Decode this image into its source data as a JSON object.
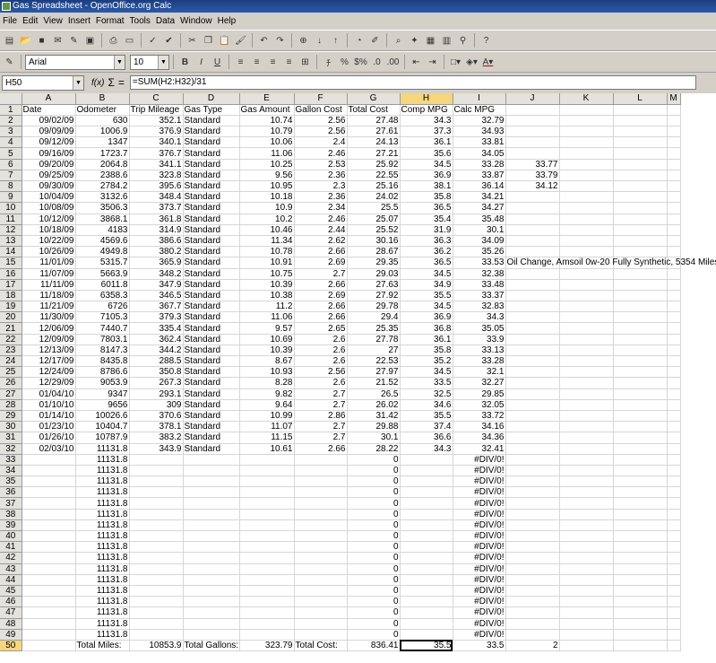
{
  "window": {
    "title": "Gas Spreadsheet - OpenOffice.org Calc"
  },
  "menu": [
    "File",
    "Edit",
    "View",
    "Insert",
    "Format",
    "Tools",
    "Data",
    "Window",
    "Help"
  ],
  "toolbar": {
    "standard_icons": [
      "new-document",
      "open-folder",
      "save",
      "email",
      "edit-file",
      "export-pdf",
      "print",
      "page-preview",
      "spellcheck",
      "autospellcheck",
      "cut",
      "copy",
      "paste",
      "clone-format",
      "undo",
      "redo",
      "hyperlink",
      "sort-ascending",
      "sort-descending",
      "insert-chart",
      "draw-functions",
      "find-replace",
      "navigator",
      "gallery",
      "datasource",
      "zoom",
      "help"
    ],
    "font_name": "Arial",
    "font_size": "10",
    "format_icons": [
      "bold",
      "italic",
      "underline",
      "align-left",
      "align-center",
      "align-right",
      "justify",
      "merge",
      "currency",
      "percent",
      "standard-format",
      "add-decimal",
      "delete-decimal",
      "decrease-indent",
      "increase-indent",
      "borders",
      "background-color",
      "font-color"
    ],
    "labels": {
      "bold": "B",
      "italic": "I",
      "underline": "U",
      "currency": "$",
      "percent": "%",
      "standard": "$%"
    }
  },
  "formula_bar": {
    "cell_ref": "H50",
    "fx": "f(x)",
    "sum": "Σ",
    "equals": "=",
    "formula": "=SUM(H2:H32)/31"
  },
  "sheet": {
    "columns": [
      "A",
      "B",
      "C",
      "D",
      "E",
      "F",
      "G",
      "H",
      "I",
      "J",
      "K",
      "L",
      "M"
    ],
    "selected_column": "H",
    "selected_row": "50",
    "active_cell": "H50",
    "rows": [
      [
        "1",
        "Date",
        "Odometer",
        "Trip Mileage",
        "Gas Type",
        "Gas Amount",
        "Gallon Cost",
        "Total Cost",
        "Comp MPG",
        "Calc MPG",
        "",
        "",
        "",
        ""
      ],
      [
        "2",
        "09/02/09",
        "630",
        "352.1",
        "Standard",
        "10.74",
        "2.56",
        "27.48",
        "34.3",
        "32.79",
        "",
        "",
        "",
        ""
      ],
      [
        "3",
        "09/09/09",
        "1006.9",
        "376.9",
        "Standard",
        "10.79",
        "2.56",
        "27.61",
        "37.3",
        "34.93",
        "",
        "",
        "",
        ""
      ],
      [
        "4",
        "09/12/09",
        "1347",
        "340.1",
        "Standard",
        "10.06",
        "2.4",
        "24.13",
        "36.1",
        "33.81",
        "",
        "",
        "",
        ""
      ],
      [
        "5",
        "09/16/09",
        "1723.7",
        "376.7",
        "Standard",
        "11.06",
        "2.46",
        "27.21",
        "35.6",
        "34.05",
        "",
        "",
        "",
        ""
      ],
      [
        "6",
        "09/20/09",
        "2064.8",
        "341.1",
        "Standard",
        "10.25",
        "2.53",
        "25.92",
        "34.5",
        "33.28",
        "33.77",
        "",
        "",
        ""
      ],
      [
        "7",
        "09/25/09",
        "2388.6",
        "323.8",
        "Standard",
        "9.56",
        "2.36",
        "22.55",
        "36.9",
        "33.87",
        "33.79",
        "",
        "",
        ""
      ],
      [
        "8",
        "09/30/09",
        "2784.2",
        "395.6",
        "Standard",
        "10.95",
        "2.3",
        "25.16",
        "38.1",
        "36.14",
        "34.12",
        "",
        "",
        ""
      ],
      [
        "9",
        "10/04/09",
        "3132.6",
        "348.4",
        "Standard",
        "10.18",
        "2.36",
        "24.02",
        "35.8",
        "34.21",
        "",
        "",
        "",
        ""
      ],
      [
        "10",
        "10/08/09",
        "3506.3",
        "373.7",
        "Standard",
        "10.9",
        "2.34",
        "25.5",
        "36.5",
        "34.27",
        "",
        "",
        "",
        ""
      ],
      [
        "11",
        "10/12/09",
        "3868.1",
        "361.8",
        "Standard",
        "10.2",
        "2.46",
        "25.07",
        "35.4",
        "35.48",
        "",
        "",
        "",
        ""
      ],
      [
        "12",
        "10/18/09",
        "4183",
        "314.9",
        "Standard",
        "10.46",
        "2.44",
        "25.52",
        "31.9",
        "30.1",
        "",
        "",
        "",
        ""
      ],
      [
        "13",
        "10/22/09",
        "4569.6",
        "386.6",
        "Standard",
        "11.34",
        "2.62",
        "30.16",
        "36.3",
        "34.09",
        "",
        "",
        "",
        ""
      ],
      [
        "14",
        "10/26/09",
        "4949.8",
        "380.2",
        "Standard",
        "10.78",
        "2.66",
        "28.67",
        "36.2",
        "35.26",
        "",
        "",
        "",
        ""
      ],
      [
        "15",
        "11/01/09",
        "5315.7",
        "365.9",
        "Standard",
        "10.91",
        "2.69",
        "29.35",
        "36.5",
        "33.53",
        "Oil Change, Amsoil 0w-20 Fully Synthetic, 5354 Miles",
        "",
        "",
        ""
      ],
      [
        "16",
        "11/07/09",
        "5663.9",
        "348.2",
        "Standard",
        "10.75",
        "2.7",
        "29.03",
        "34.5",
        "32.38",
        "",
        "",
        "",
        ""
      ],
      [
        "17",
        "11/11/09",
        "6011.8",
        "347.9",
        "Standard",
        "10.39",
        "2.66",
        "27.63",
        "34.9",
        "33.48",
        "",
        "",
        "",
        ""
      ],
      [
        "18",
        "11/18/09",
        "6358.3",
        "346.5",
        "Standard",
        "10.38",
        "2.69",
        "27.92",
        "35.5",
        "33.37",
        "",
        "",
        "",
        ""
      ],
      [
        "19",
        "11/21/09",
        "6726",
        "367.7",
        "Standard",
        "11.2",
        "2.66",
        "29.78",
        "34.5",
        "32.83",
        "",
        "",
        "",
        ""
      ],
      [
        "20",
        "11/30/09",
        "7105.3",
        "379.3",
        "Standard",
        "11.06",
        "2.66",
        "29.4",
        "36.9",
        "34.3",
        "",
        "",
        "",
        ""
      ],
      [
        "21",
        "12/06/09",
        "7440.7",
        "335.4",
        "Standard",
        "9.57",
        "2.65",
        "25.35",
        "36.8",
        "35.05",
        "",
        "",
        "",
        ""
      ],
      [
        "22",
        "12/09/09",
        "7803.1",
        "362.4",
        "Standard",
        "10.69",
        "2.6",
        "27.78",
        "36.1",
        "33.9",
        "",
        "",
        "",
        ""
      ],
      [
        "23",
        "12/13/09",
        "8147.3",
        "344.2",
        "Standard",
        "10.39",
        "2.6",
        "27",
        "35.8",
        "33.13",
        "",
        "",
        "",
        ""
      ],
      [
        "24",
        "12/17/09",
        "8435.8",
        "288.5",
        "Standard",
        "8.67",
        "2.6",
        "22.53",
        "35.2",
        "33.28",
        "",
        "",
        "",
        ""
      ],
      [
        "25",
        "12/24/09",
        "8786.6",
        "350.8",
        "Standard",
        "10.93",
        "2.56",
        "27.97",
        "34.5",
        "32.1",
        "",
        "",
        "",
        ""
      ],
      [
        "26",
        "12/29/09",
        "9053.9",
        "267.3",
        "Standard",
        "8.28",
        "2.6",
        "21.52",
        "33.5",
        "32.27",
        "",
        "",
        "",
        ""
      ],
      [
        "27",
        "01/04/10",
        "9347",
        "293.1",
        "Standard",
        "9.82",
        "2.7",
        "26.5",
        "32.5",
        "29.85",
        "",
        "",
        "",
        ""
      ],
      [
        "28",
        "01/10/10",
        "9656",
        "309",
        "Standard",
        "9.64",
        "2.7",
        "26.02",
        "34.6",
        "32.05",
        "",
        "",
        "",
        ""
      ],
      [
        "29",
        "01/14/10",
        "10026.6",
        "370.6",
        "Standard",
        "10.99",
        "2.86",
        "31.42",
        "35.5",
        "33.72",
        "",
        "",
        "",
        ""
      ],
      [
        "30",
        "01/23/10",
        "10404.7",
        "378.1",
        "Standard",
        "11.07",
        "2.7",
        "29.88",
        "37.4",
        "34.16",
        "",
        "",
        "",
        ""
      ],
      [
        "31",
        "01/26/10",
        "10787.9",
        "383.2",
        "Standard",
        "11.15",
        "2.7",
        "30.1",
        "36.6",
        "34.36",
        "",
        "",
        "",
        ""
      ],
      [
        "32",
        "02/03/10",
        "11131.8",
        "343.9",
        "Standard",
        "10.61",
        "2.66",
        "28.22",
        "34.3",
        "32.41",
        "",
        "",
        "",
        ""
      ],
      [
        "33",
        "",
        "11131.8",
        "",
        "",
        "",
        "",
        "0",
        "",
        "#DIV/0!",
        "",
        "",
        "",
        ""
      ],
      [
        "34",
        "",
        "11131.8",
        "",
        "",
        "",
        "",
        "0",
        "",
        "#DIV/0!",
        "",
        "",
        "",
        ""
      ],
      [
        "35",
        "",
        "11131.8",
        "",
        "",
        "",
        "",
        "0",
        "",
        "#DIV/0!",
        "",
        "",
        "",
        ""
      ],
      [
        "36",
        "",
        "11131.8",
        "",
        "",
        "",
        "",
        "0",
        "",
        "#DIV/0!",
        "",
        "",
        "",
        ""
      ],
      [
        "37",
        "",
        "11131.8",
        "",
        "",
        "",
        "",
        "0",
        "",
        "#DIV/0!",
        "",
        "",
        "",
        ""
      ],
      [
        "38",
        "",
        "11131.8",
        "",
        "",
        "",
        "",
        "0",
        "",
        "#DIV/0!",
        "",
        "",
        "",
        ""
      ],
      [
        "39",
        "",
        "11131.8",
        "",
        "",
        "",
        "",
        "0",
        "",
        "#DIV/0!",
        "",
        "",
        "",
        ""
      ],
      [
        "40",
        "",
        "11131.8",
        "",
        "",
        "",
        "",
        "0",
        "",
        "#DIV/0!",
        "",
        "",
        "",
        ""
      ],
      [
        "41",
        "",
        "11131.8",
        "",
        "",
        "",
        "",
        "0",
        "",
        "#DIV/0!",
        "",
        "",
        "",
        ""
      ],
      [
        "42",
        "",
        "11131.8",
        "",
        "",
        "",
        "",
        "0",
        "",
        "#DIV/0!",
        "",
        "",
        "",
        ""
      ],
      [
        "43",
        "",
        "11131.8",
        "",
        "",
        "",
        "",
        "0",
        "",
        "#DIV/0!",
        "",
        "",
        "",
        ""
      ],
      [
        "44",
        "",
        "11131.8",
        "",
        "",
        "",
        "",
        "0",
        "",
        "#DIV/0!",
        "",
        "",
        "",
        ""
      ],
      [
        "45",
        "",
        "11131.8",
        "",
        "",
        "",
        "",
        "0",
        "",
        "#DIV/0!",
        "",
        "",
        "",
        ""
      ],
      [
        "46",
        "",
        "11131.8",
        "",
        "",
        "",
        "",
        "0",
        "",
        "#DIV/0!",
        "",
        "",
        "",
        ""
      ],
      [
        "47",
        "",
        "11131.8",
        "",
        "",
        "",
        "",
        "0",
        "",
        "#DIV/0!",
        "",
        "",
        "",
        ""
      ],
      [
        "48",
        "",
        "11131.8",
        "",
        "",
        "",
        "",
        "0",
        "",
        "#DIV/0!",
        "",
        "",
        "",
        ""
      ],
      [
        "49",
        "",
        "11131.8",
        "",
        "",
        "",
        "",
        "0",
        "",
        "#DIV/0!",
        "",
        "",
        "",
        ""
      ],
      [
        "50",
        "",
        "Total Miles:",
        "10853.9",
        "Total Gallons:",
        "323.79",
        "Total Cost:",
        "836.41",
        "35.5",
        "33.5",
        "2",
        "",
        "",
        ""
      ]
    ]
  }
}
